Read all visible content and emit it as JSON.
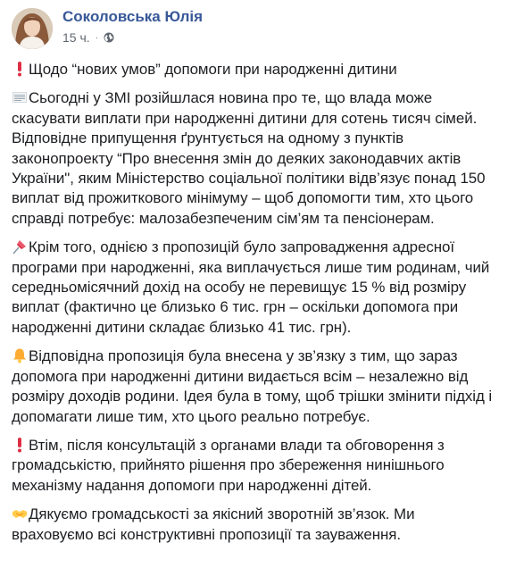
{
  "post": {
    "author": "Соколовська Юлія",
    "time": "15 ч.",
    "separator": "·",
    "privacy_icon": "globe-icon"
  },
  "paragraphs": [
    {
      "emoji": "exclamation-icon",
      "lines": [
        "Щодо “нових умов” допомоги при народженні дитини"
      ]
    },
    {
      "emoji": "newspaper-icon",
      "lines": [
        "Сьогодні у ЗМІ розійшлася новина про те, що влада може",
        "скасувати виплати при народженні дитини для сотень тисяч сімей.",
        "Відповідне припущення ґрунтується на одному з пунктів",
        "законопроекту “Про внесення змін до деяких законодавчих актів",
        "України\", яким Міністерство соціальної політики відв’язує понад 150",
        "виплат від прожиткового мінімуму – щоб допомогти тим, хто цього",
        "справді потребує: малозабезпеченим сім’ям та пенсіонерам."
      ]
    },
    {
      "emoji": "pushpin-icon",
      "lines": [
        "Крім того, однією з пропозицій було запровадження адресної",
        "програми при народженні, яка виплачується лише тим родинам, чий",
        "середньомісячний дохід на особу не перевищує 15 % від розміру",
        "виплат (фактично це близько 6 тис. грн – оскільки допомога при",
        "народженні дитини складає близько 41 тис. грн)."
      ]
    },
    {
      "emoji": "bell-icon",
      "lines": [
        "Відповідна пропозиція була внесена у зв’язку з тим, що зараз",
        "допомога при народженні дитини видається всім – незалежно від",
        "розміру доходів родини. Ідея була в тому, щоб трішки змінити підхід і",
        "допомагати лише тим, хто цього реально потребує."
      ]
    },
    {
      "emoji": "exclamation-icon",
      "lines": [
        "Втім, після консультацій з органами влади та обговорення з",
        "громадськістю, прийнято рішення про збереження нинішнього",
        "механізму надання допомоги при народженні дітей."
      ]
    },
    {
      "emoji": "handshake-icon",
      "lines": [
        "Дякуємо громадськості за якісний зворотній зв’язок. Ми",
        "враховуємо всі конструктивні пропозиції та зауваження."
      ]
    }
  ]
}
